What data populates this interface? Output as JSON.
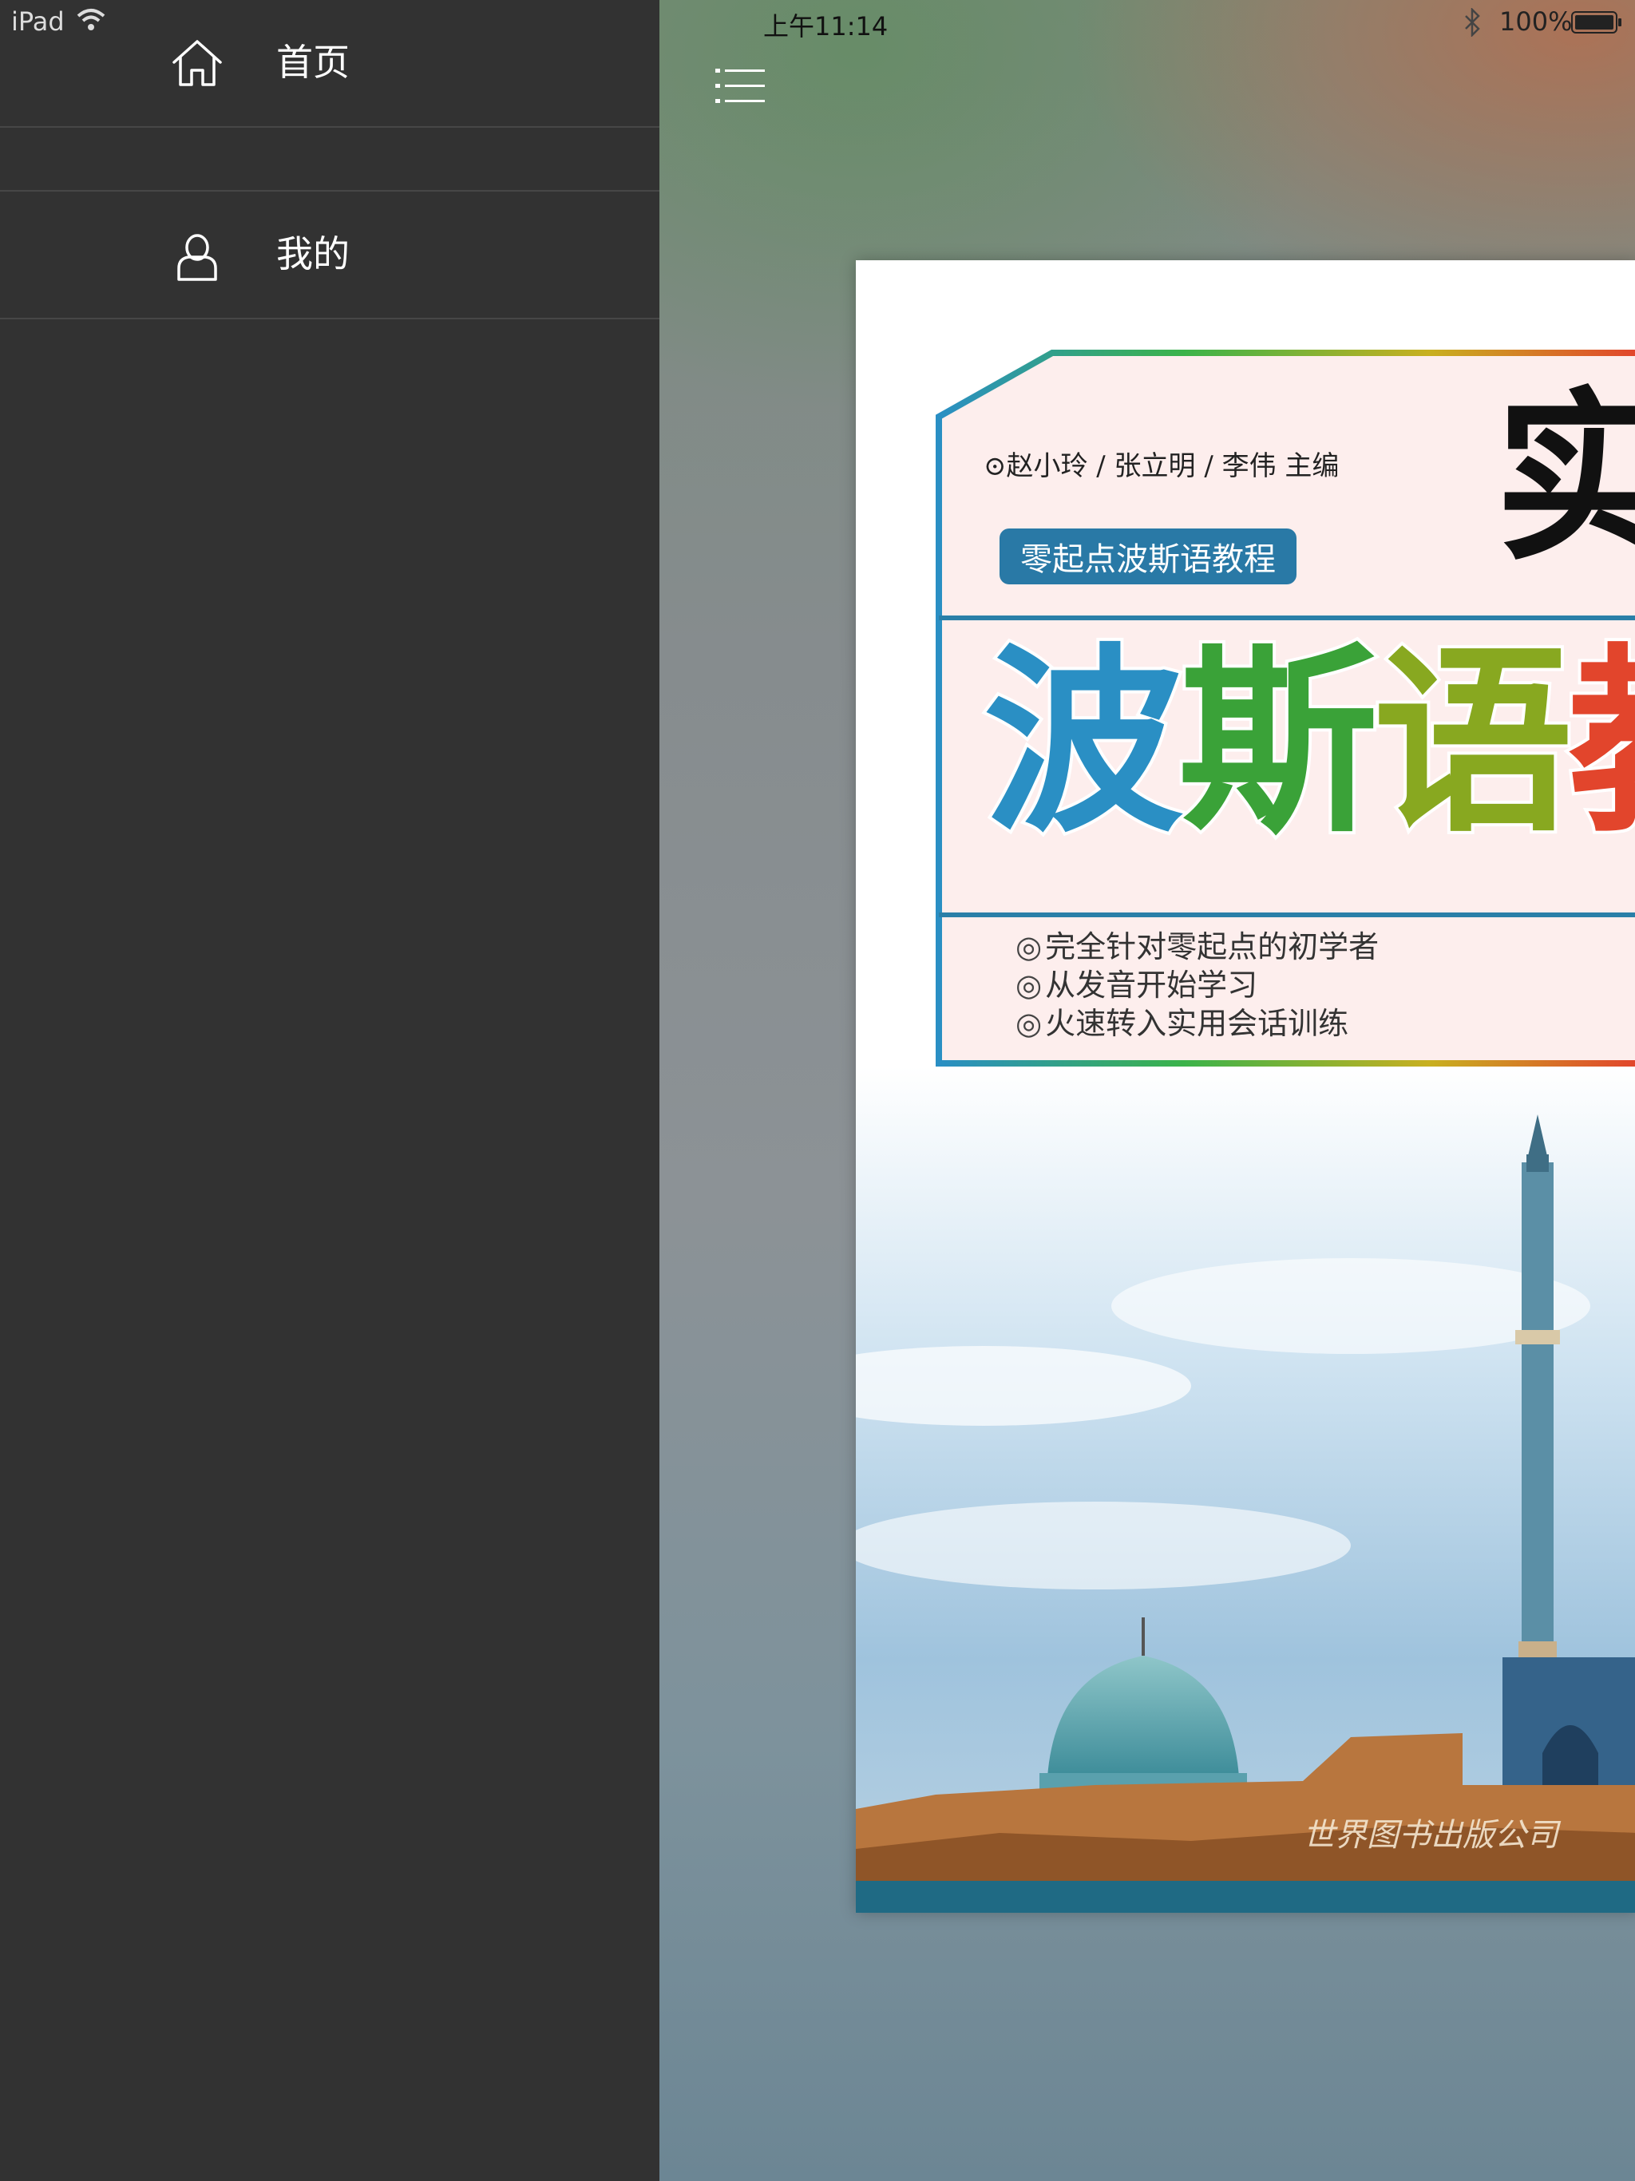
{
  "status_bar": {
    "device": "iPad",
    "time": "上午11:14",
    "battery": "100%"
  },
  "sidebar": {
    "items": [
      {
        "label": "首页",
        "icon": "home-icon"
      },
      {
        "label": "我的",
        "icon": "user-icon"
      }
    ]
  },
  "main": {
    "menu_icon": "list-icon"
  },
  "cover": {
    "editors": "⊙赵小玲 / 张立明 / 李伟  主编",
    "series": "零起点波斯语教程",
    "big_char": "实",
    "title_chars": [
      "波",
      "斯",
      "语",
      "教"
    ],
    "features": [
      "完全针对零起点的初学者",
      "从发音开始学习",
      "火速转入实用会话训练"
    ],
    "publisher": "世界图书出版公司"
  },
  "colors": {
    "sidebar_bg": "#323232",
    "sidebar_divider": "#474747",
    "badge_blue": "#2979a6"
  }
}
